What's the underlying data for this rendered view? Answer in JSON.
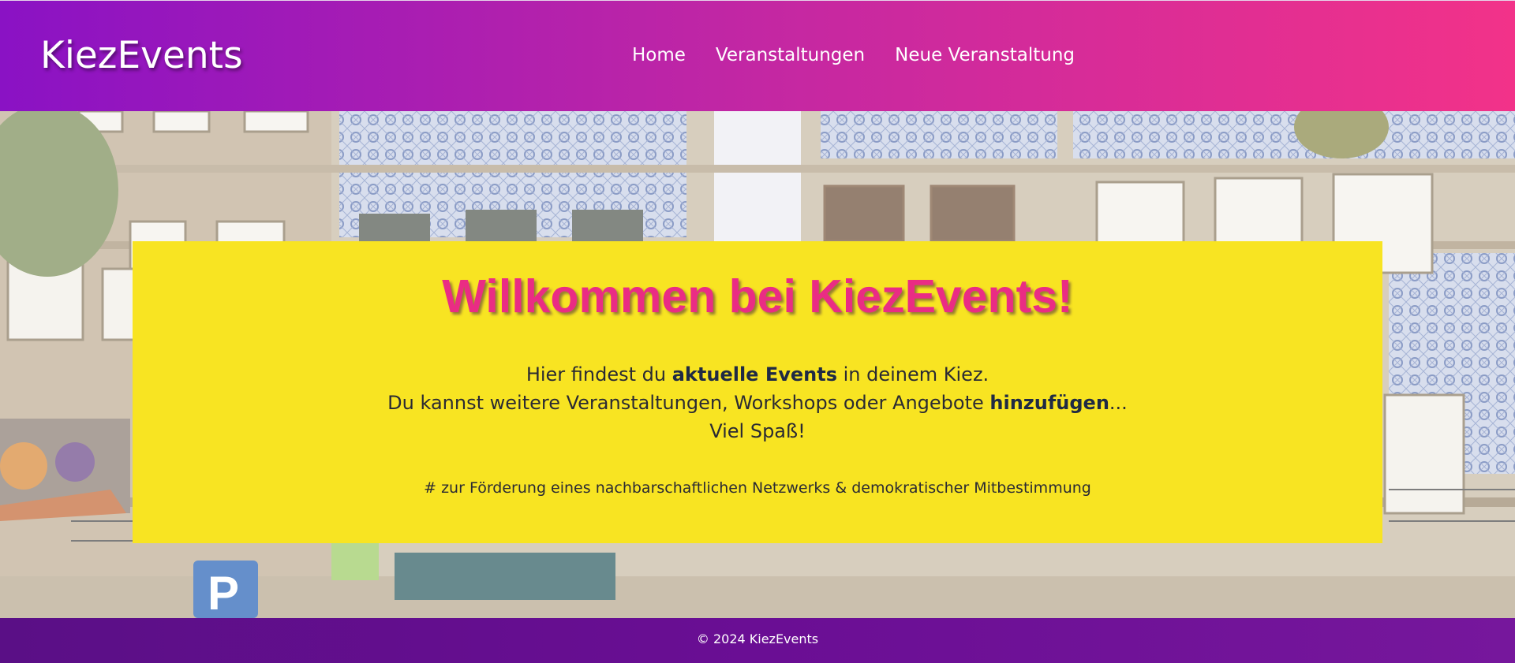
{
  "header": {
    "brand": "KiezEvents",
    "nav": [
      {
        "label": "Home"
      },
      {
        "label": "Veranstaltungen"
      },
      {
        "label": "Neue Veranstaltung"
      }
    ],
    "colors": {
      "gradient_start": "#8a12c4",
      "gradient_end": "#f23289"
    }
  },
  "hero": {
    "title": "Willkommen bei KiezEvents!",
    "line1": {
      "pre": "Hier findest du ",
      "bold": "aktuelle Events",
      "post": " in deinem Kiez."
    },
    "line2": {
      "pre": "Du kannst weitere Veranstaltungen, Workshops oder Angebote ",
      "bold": "hinzufügen",
      "post": "..."
    },
    "line3": "Viel Spaß!",
    "tagline": "# zur Förderung eines nachbarschaftlichen Netzwerks & demokratischer Mitbestimmung",
    "colors": {
      "card": "#f8e422",
      "title": "#ea2c84"
    }
  },
  "footer": {
    "text": "© 2024 KiezEvents"
  }
}
